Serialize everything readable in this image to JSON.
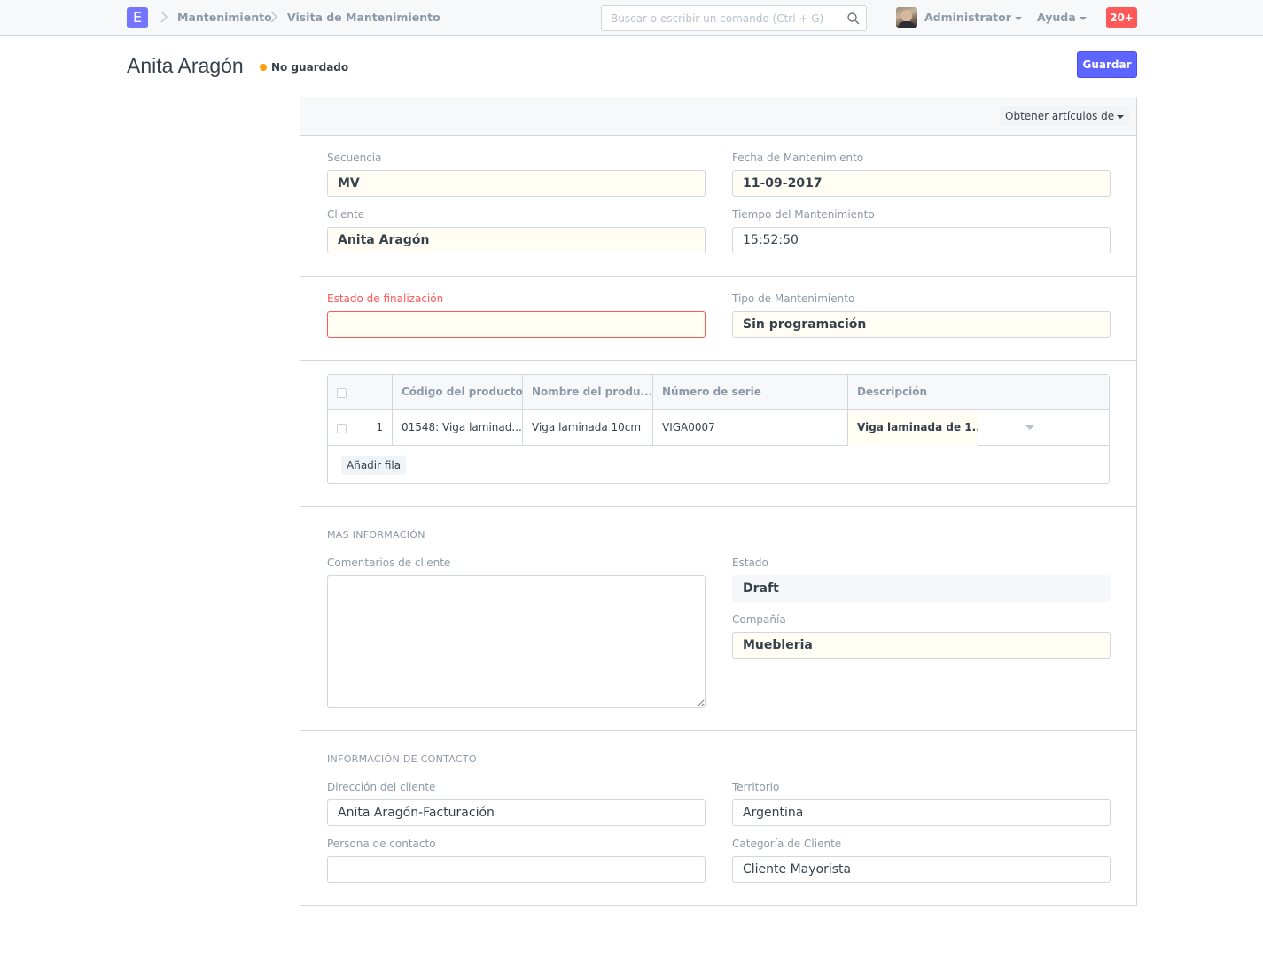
{
  "navbar": {
    "logo_letter": "E",
    "breadcrumbs": [
      "Mantenimiento",
      "Visita de Mantenimiento"
    ],
    "search_placeholder": "Buscar o escribir un comando (Ctrl + G)",
    "user": "Administrator",
    "help": "Ayuda",
    "notifications": "20+"
  },
  "page": {
    "title": "Anita Aragón",
    "status": "No guardado",
    "status_color": "#ffa00a",
    "save_label": "Guardar"
  },
  "toolbar": {
    "get_items_label": "Obtener artículos de"
  },
  "fields": {
    "secuencia": {
      "label": "Secuencia",
      "value": "MV"
    },
    "fecha": {
      "label": "Fecha de Mantenimiento",
      "value": "11-09-2017"
    },
    "cliente": {
      "label": "Cliente",
      "value": "Anita Aragón"
    },
    "tiempo": {
      "label": "Tiempo del Mantenimiento",
      "value": "15:52:50"
    },
    "estado_fin": {
      "label": "Estado de finalización",
      "value": ""
    },
    "tipo": {
      "label": "Tipo de Mantenimiento",
      "value": "Sin programación"
    }
  },
  "table": {
    "headers": [
      "Código del producto",
      "Nombre del produ...",
      "Número de serie",
      "Descripción"
    ],
    "rows": [
      {
        "idx": "1",
        "code": "01548: Viga laminad...",
        "name": "Viga laminada 10cm",
        "serial": "VIGA0007",
        "description": "Viga laminada de 1..."
      }
    ],
    "add_row_label": "Añadir fila"
  },
  "more_info": {
    "heading": "MAS INFORMACIÓN",
    "comments_label": "Comentarios de cliente",
    "comments_value": "",
    "status_label": "Estado",
    "status_value": "Draft",
    "company_label": "Compañía",
    "company_value": "Muebleria"
  },
  "contact": {
    "heading": "INFORMACIÓN DE CONTACTO",
    "address_label": "Dirección del cliente",
    "address_value": "Anita Aragón-Facturación",
    "territory_label": "Territorio",
    "territory_value": "Argentina",
    "person_label": "Persona de contacto",
    "person_value": "",
    "group_label": "Categoría de Cliente",
    "group_value": "Cliente Mayorista"
  },
  "colors": {
    "primary": "#5e64ff",
    "error": "#ff5858",
    "notification": "#ff5858",
    "unsaved_dot": "#ffa00a"
  }
}
